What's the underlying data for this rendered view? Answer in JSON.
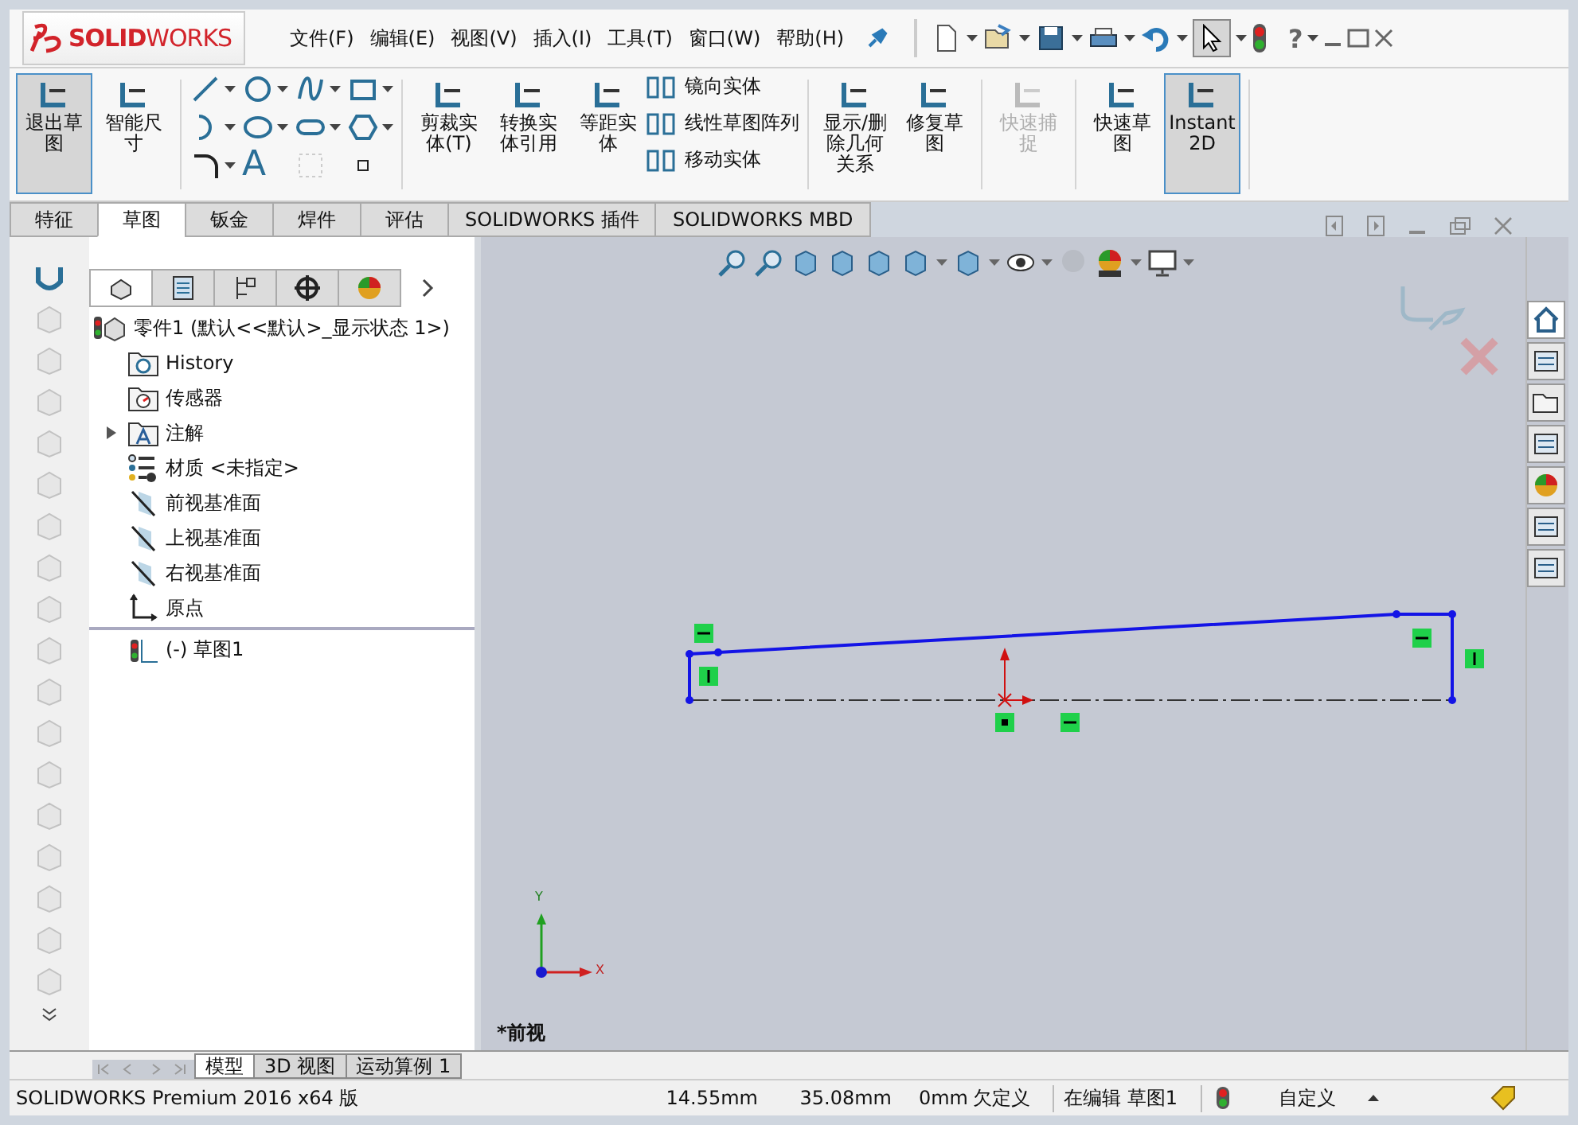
{
  "title_bar": {
    "logo": "**SOLID**WORKS",
    "menu": [
      "文件(F)",
      "编辑(E)",
      "视图(V)",
      "插入(I)",
      "工具(T)",
      "窗口(W)",
      "帮助(H)"
    ],
    "select_tool": {
      "selected": true
    },
    "help": "?"
  },
  "ribbon": {
    "sections": [
      {
        "kind": "big",
        "buttons": [
          {
            "label": "退出草图",
            "selected": true,
            "disabled": false
          },
          {
            "label": "智能尺寸",
            "selected": false,
            "disabled": false
          }
        ]
      },
      {
        "kind": "tools",
        "text_glyph": "A"
      },
      {
        "kind": "big",
        "buttons": [
          {
            "label": "剪裁实体(T)",
            "selected": false,
            "disabled": false
          },
          {
            "label": "转换实体引用",
            "selected": false,
            "disabled": false
          },
          {
            "label": "等距实体",
            "selected": false,
            "disabled": false
          }
        ]
      },
      {
        "kind": "list",
        "buttons": [
          {
            "label": "镜向实体"
          },
          {
            "label": "线性草图阵列"
          },
          {
            "label": "移动实体"
          }
        ]
      },
      {
        "kind": "big",
        "buttons": [
          {
            "label": "显示/删除几何关系",
            "selected": false,
            "disabled": false
          },
          {
            "label": "修复草图",
            "selected": false,
            "disabled": false
          }
        ]
      },
      {
        "kind": "big",
        "buttons": [
          {
            "label": "快速捕捉",
            "selected": false,
            "disabled": true
          }
        ]
      },
      {
        "kind": "big",
        "buttons": [
          {
            "label": "快速草图",
            "selected": false,
            "disabled": false
          },
          {
            "label": "Instant2D",
            "selected": true,
            "disabled": false
          }
        ]
      }
    ]
  },
  "tabs": [
    {
      "label": "特征",
      "selected": false
    },
    {
      "label": "草图",
      "selected": true
    },
    {
      "label": "钣金",
      "selected": false
    },
    {
      "label": "焊件",
      "selected": false
    },
    {
      "label": "评估",
      "selected": false
    },
    {
      "label": "SOLIDWORKS 插件",
      "selected": false
    },
    {
      "label": "SOLIDWORKS MBD",
      "selected": false
    }
  ],
  "feature_tree": {
    "tabs": [
      {
        "selected": true
      },
      {
        "selected": false
      },
      {
        "selected": false
      },
      {
        "selected": false
      },
      {
        "selected": false
      }
    ],
    "root": {
      "label": "零件1 (默认<<默认>_显示状态 1>)",
      "children": [
        {
          "kind": "history",
          "label": "History"
        },
        {
          "kind": "sensors",
          "label": "传感器"
        },
        {
          "kind": "annotations",
          "label": "注解",
          "expanded": false
        },
        {
          "kind": "material",
          "label": "材质 <未指定>"
        },
        {
          "kind": "plane",
          "label": "前视基准面"
        },
        {
          "kind": "plane",
          "label": "上视基准面"
        },
        {
          "kind": "plane",
          "label": "右视基准面"
        },
        {
          "kind": "origin",
          "label": "原点"
        },
        {
          "kind": "sketch",
          "label": "(-) 草图1"
        }
      ]
    }
  },
  "task_pane": [
    {
      "selected": true
    },
    {
      "selected": false
    },
    {
      "selected": false
    },
    {
      "selected": false
    },
    {
      "selected": false
    },
    {
      "selected": false
    },
    {
      "selected": false
    }
  ],
  "viewport": {
    "view_label": "*前视",
    "triad": {
      "x": "X",
      "y": "Y"
    }
  },
  "bottom_tabs": [
    {
      "label": "模型",
      "selected": true
    },
    {
      "label": "3D 视图",
      "selected": false
    },
    {
      "label": "运动算例 1",
      "selected": false
    }
  ],
  "status_bar": {
    "product": "SOLIDWORKS Premium 2016 x64 版",
    "x": "14.55mm",
    "y": "35.08mm",
    "z": "0mm",
    "state": "欠定义",
    "editing": "在编辑 草图1",
    "units": "自定义"
  }
}
